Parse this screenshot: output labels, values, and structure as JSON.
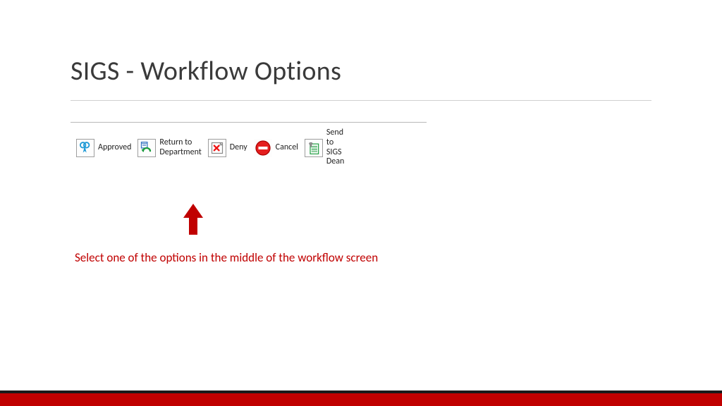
{
  "title": "SIGS - Workflow Options",
  "toolbar": {
    "approved": "Approved",
    "return": "Return to\nDepartment",
    "deny": "Deny",
    "cancel": "Cancel",
    "send": "Send\nto\nSIGS\nDean"
  },
  "instruction": "Select one of the options in the middle of the workflow screen",
  "colors": {
    "accent": "#c00000"
  }
}
